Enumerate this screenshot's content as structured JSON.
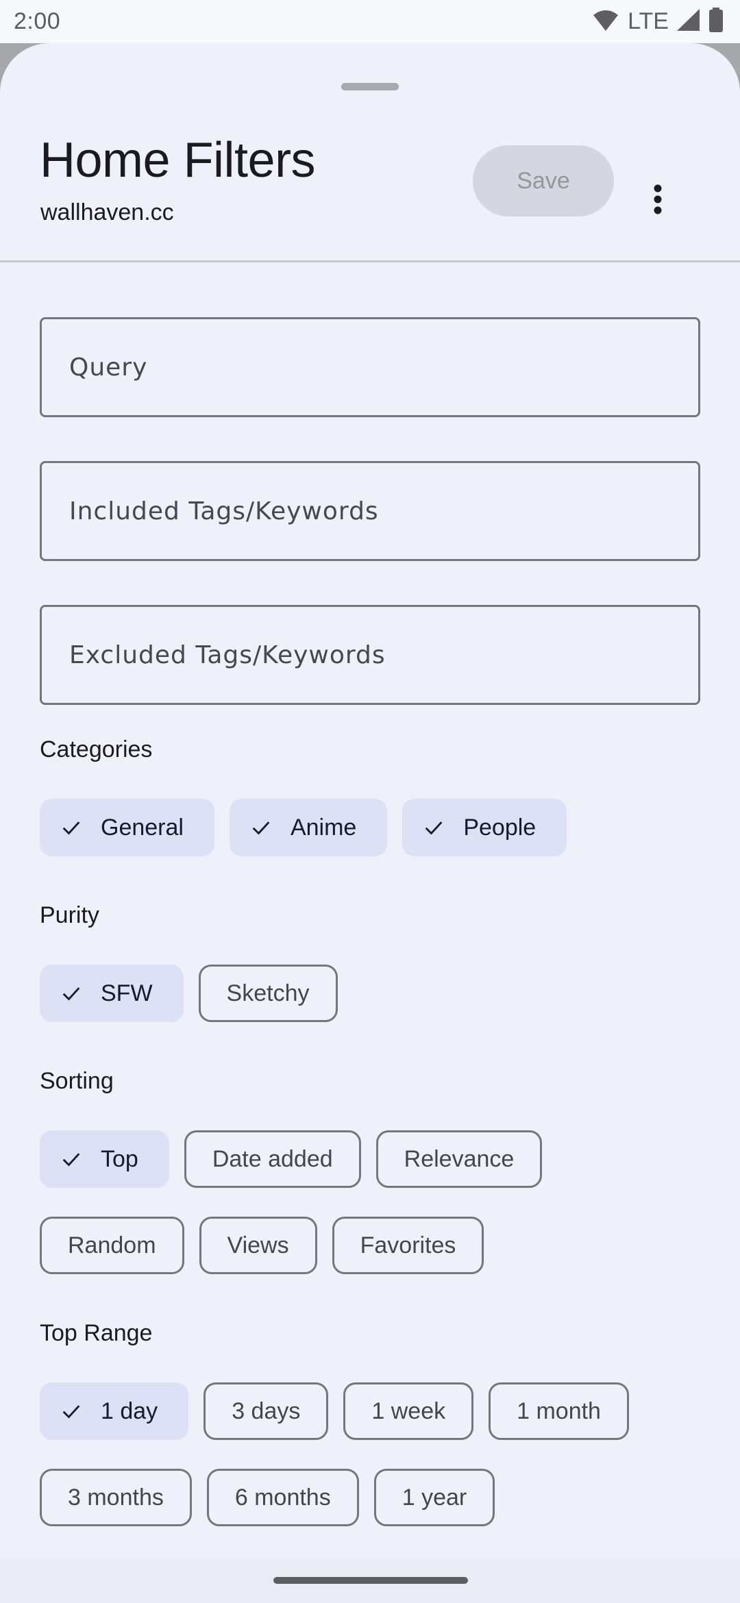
{
  "status_bar": {
    "time": "2:00",
    "network_label": "LTE",
    "icons": [
      "wifi-icon",
      "lte-label",
      "cell-signal-icon",
      "battery-icon"
    ]
  },
  "header": {
    "title": "Home Filters",
    "subtitle": "wallhaven.cc",
    "save_label": "Save",
    "save_enabled": false,
    "more_icon": "more-vert-icon"
  },
  "fields": [
    {
      "name": "query",
      "placeholder": "Query",
      "value": ""
    },
    {
      "name": "included-tags",
      "placeholder": "Included Tags/Keywords",
      "value": ""
    },
    {
      "name": "excluded-tags",
      "placeholder": "Excluded Tags/Keywords",
      "value": ""
    }
  ],
  "sections": {
    "categories": {
      "label": "Categories",
      "chips": [
        {
          "label": "General",
          "selected": true
        },
        {
          "label": "Anime",
          "selected": true
        },
        {
          "label": "People",
          "selected": true
        }
      ]
    },
    "purity": {
      "label": "Purity",
      "chips": [
        {
          "label": "SFW",
          "selected": true
        },
        {
          "label": "Sketchy",
          "selected": false
        }
      ]
    },
    "sorting": {
      "label": "Sorting",
      "chips": [
        {
          "label": "Top",
          "selected": true
        },
        {
          "label": "Date added",
          "selected": false
        },
        {
          "label": "Relevance",
          "selected": false
        },
        {
          "label": "Random",
          "selected": false
        },
        {
          "label": "Views",
          "selected": false
        },
        {
          "label": "Favorites",
          "selected": false
        }
      ]
    },
    "top_range": {
      "label": "Top Range",
      "chips": [
        {
          "label": "1 day",
          "selected": true
        },
        {
          "label": "3 days",
          "selected": false
        },
        {
          "label": "1 week",
          "selected": false
        },
        {
          "label": "1 month",
          "selected": false
        },
        {
          "label": "3 months",
          "selected": false
        },
        {
          "label": "6 months",
          "selected": false
        },
        {
          "label": "1 year",
          "selected": false
        }
      ]
    }
  },
  "colors": {
    "sheet_background": "#eef1f9",
    "chip_selected": "#dde1f6",
    "outline": "#74757d",
    "save_disabled_bg": "#d4d7e0",
    "save_disabled_text": "#95969d"
  }
}
